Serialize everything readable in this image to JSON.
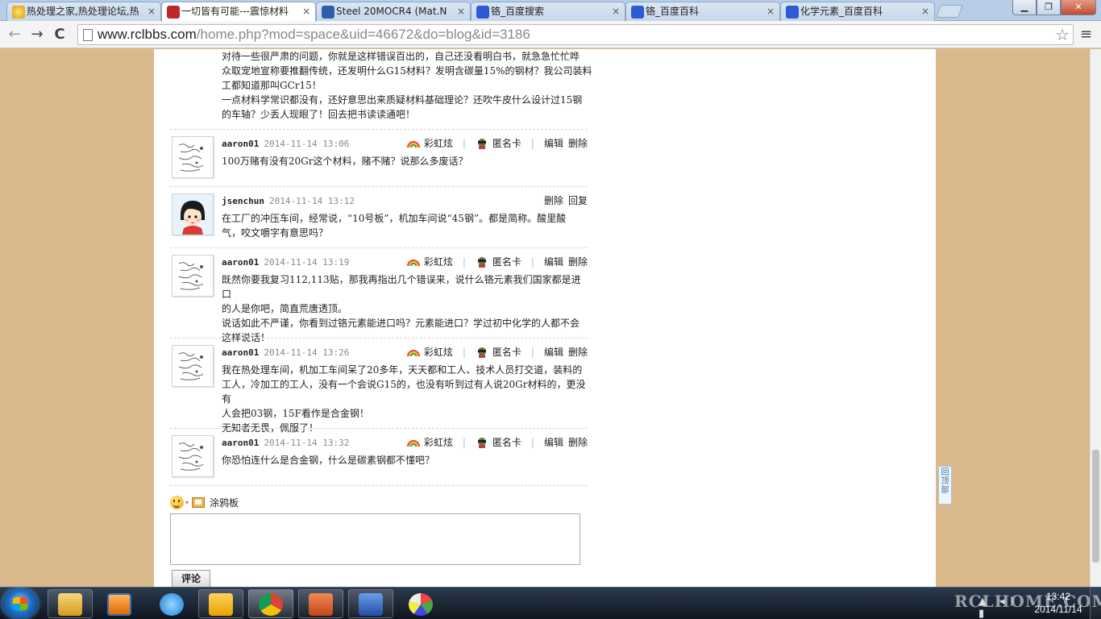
{
  "browser": {
    "tabs": [
      {
        "title": "热处理之家,热处理论坛,热",
        "icon": "bulb-icon",
        "active": false
      },
      {
        "title": "一切皆有可能---震惊材料",
        "icon": "rcl-logo-icon",
        "active": true
      },
      {
        "title": "Steel 20MOCR4 (Mat.N",
        "icon": "matweb-icon",
        "active": false
      },
      {
        "title": "铬_百度搜索",
        "icon": "baidu-paw-icon",
        "active": false
      },
      {
        "title": "铬_百度百科",
        "icon": "baidu-paw-icon",
        "active": false
      },
      {
        "title": "化学元素_百度百科",
        "icon": "baidu-paw-icon",
        "active": false
      }
    ],
    "tab_close_glyph": "×",
    "url_host": "www.rclbbs.com",
    "url_path": "/home.php?mod=space&uid=46672&do=blog&id=3186",
    "back_glyph": "←",
    "forward_glyph": "→",
    "reload_glyph": "C",
    "star_glyph": "☆",
    "menu_glyph": "≡",
    "window": {
      "minimize": "▁",
      "maximize": "❐",
      "close": "✕"
    }
  },
  "intro_lines": [
    "对待一些很严肃的问题，你就是这样错误百出的，自己还没看明白书，就急急忙忙哗",
    "众取宠地宣称要推翻传统，还发明什么G15材料？发明含碳量15%的钢材？我公司装料",
    "工都知道那叫GCr15！",
    "一点材料学常识都没有，还好意思出来质疑材料基础理论？还吹牛皮什么设计过15钢",
    "的车轴？少丢人现眼了！回去把书读读通吧！"
  ],
  "action_labels": {
    "rainbow": "彩虹炫",
    "anon": "匿名卡",
    "edit": "编辑",
    "delete": "删除",
    "reply": "回复",
    "sep": "|"
  },
  "comments": [
    {
      "author": "aaron01",
      "time": "2014-11-14 13:06",
      "lines": [
        "100万赌有没有20Gr这个材料，赌不赌？说那么多废话？"
      ]
    },
    {
      "author": "jsenchun",
      "time": "2014-11-14 13:12",
      "lines": [
        "在工厂的冲压车间，经常说，“10号板”，机加车间说“45钢”。都是简称。酸里酸",
        "气，咬文嚼字有意思吗？"
      ]
    },
    {
      "author": "aaron01",
      "time": "2014-11-14 13:19",
      "lines": [
        "既然你要我复习112,113贴，那我再指出几个错误来，说什么铬元素我们国家都是进口",
        "的人是你吧，简直荒唐透顶。",
        "说话如此不严谨，你看到过铬元素能进口吗？元素能进口？学过初中化学的人都不会",
        "这样说话！"
      ]
    },
    {
      "author": "aaron01",
      "time": "2014-11-14 13:26",
      "lines": [
        "我在热处理车间，机加工车间呆了20多年，天天都和工人、技术人员打交道，装料的",
        "工人，冷加工的工人，没有一个会说G15的，也没有听到过有人说20Gr材料的，更没有",
        "人会把03钢，15F看作是合金钢！",
        "无知者无畏，佩服了！"
      ]
    },
    {
      "author": "aaron01",
      "time": "2014-11-14 13:32",
      "lines": [
        "你恐怕连什么是合金钢，什么是碳素钢都不懂吧？"
      ]
    }
  ],
  "editor": {
    "doodle_label": "涂鸦板",
    "submit_label": "评论",
    "caret": "▾"
  },
  "back_to_top": "回顶部",
  "taskbar": {
    "apps": [
      "file-explorer-icon",
      "media-player-icon",
      "internet-explorer-icon",
      "outlook-icon",
      "chrome-icon",
      "powerpoint-icon",
      "word-icon",
      "paint-icon"
    ],
    "tray_icons": "▲ ◂) ▮",
    "time": "13:42",
    "date": "2014/11/14",
    "watermark": "RCLHOME.COM"
  },
  "colors": {
    "page_bg": "#d9b98b",
    "time_gray": "#8a8a8a"
  }
}
